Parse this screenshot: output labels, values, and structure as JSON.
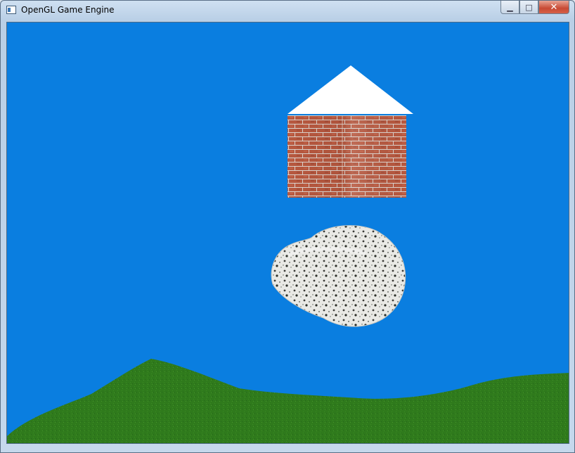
{
  "window": {
    "title": "OpenGL Game Engine",
    "minimize_symbol": "▁",
    "maximize_symbol": "□",
    "close_symbol": "✕"
  },
  "scene": {
    "sky_color": "#0a7ee0",
    "roof_color": "#ffffff",
    "brick_color": "#b7583f",
    "mortar_color": "#ddd3cc",
    "rock_color": "#e8e8e4",
    "grass_color": "#2f7a1c"
  },
  "icons": {
    "app": "window-app-icon",
    "minimize": "minimize-icon",
    "maximize": "maximize-icon",
    "close": "close-icon"
  }
}
